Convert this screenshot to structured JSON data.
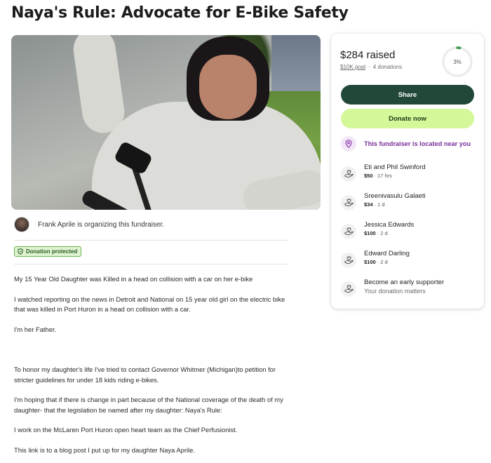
{
  "page": {
    "title": "Naya's Rule: Advocate for E-Bike Safety"
  },
  "organizer": {
    "text": "Frank Aprile is organizing this fundraiser."
  },
  "badge": {
    "label": "Donation protected"
  },
  "story": {
    "paragraphs": [
      "My 15 Year Old Daughter was Killed in a head on collision with a car on her e-bike",
      "I watched reporting on the news in Detroit and National on 15 year old girl on the electric bike that was killed in Port Huron in a head on collision with a car.",
      "I'm her Father.",
      "",
      "To honor my daughter's life I've tried to contact Governor Whitmer (Michigan)to petition for stricter guidelines for under 18 kids riding e-bikes.",
      "I'm hoping that if there is change in part because of the National coverage of the death of my daughter- that the legislation be named after my daughter: Naya's Rule:",
      "I work on the McLaren Port Huron open heart team as the Chief Perfusionist.",
      "This link is to a blog post I put up for my daughter Naya Aprile."
    ]
  },
  "card": {
    "raised": "$284 raised",
    "goal": "$10K goal",
    "donations_count": "4 donations",
    "progress_label": "3%",
    "progress_fraction": 0.03,
    "share_label": "Share",
    "donate_label": "Donate now",
    "nearby_label": "This fundraiser is located near you",
    "donors": [
      {
        "name": "Eti and Phil Swinford",
        "amount": "$50",
        "time": "17 hrs"
      },
      {
        "name": "Sreenivasulu Galaeti",
        "amount": "$34",
        "time": "1 d"
      },
      {
        "name": "Jessica Edwards",
        "amount": "$100",
        "time": "2 d"
      },
      {
        "name": "Edward Darling",
        "amount": "$100",
        "time": "2 d"
      }
    ],
    "early": {
      "title": "Become an early supporter",
      "subtitle": "Your donation matters"
    }
  },
  "colors": {
    "share_bg": "#22483a",
    "donate_bg": "#d4f79a",
    "progress": "#3a9b4c",
    "nearby_text": "#7a2d99",
    "badge_bg": "#dff3d2"
  },
  "icons": {
    "nearby": "location-pin-icon",
    "donor": "heart-hand-icon",
    "badge": "shield-icon"
  }
}
